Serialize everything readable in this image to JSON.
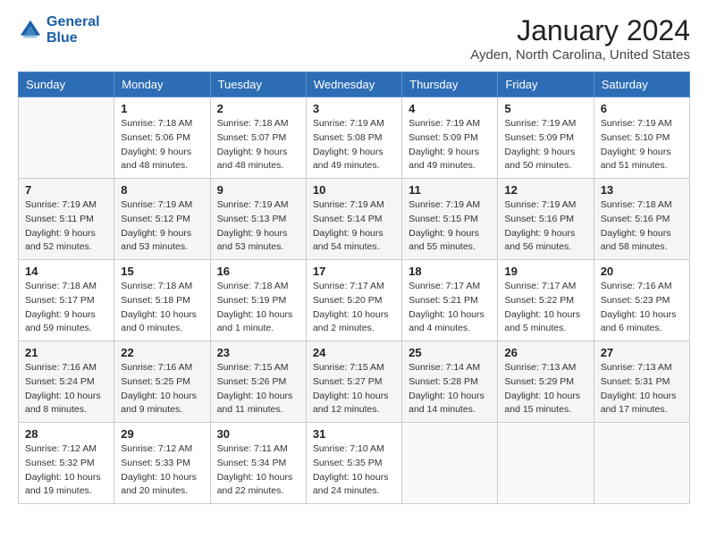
{
  "header": {
    "logo_line1": "General",
    "logo_line2": "Blue",
    "month": "January 2024",
    "location": "Ayden, North Carolina, United States"
  },
  "weekdays": [
    "Sunday",
    "Monday",
    "Tuesday",
    "Wednesday",
    "Thursday",
    "Friday",
    "Saturday"
  ],
  "weeks": [
    [
      {
        "day": "",
        "sunrise": "",
        "sunset": "",
        "daylight": ""
      },
      {
        "day": "1",
        "sunrise": "Sunrise: 7:18 AM",
        "sunset": "Sunset: 5:06 PM",
        "daylight": "Daylight: 9 hours and 48 minutes."
      },
      {
        "day": "2",
        "sunrise": "Sunrise: 7:18 AM",
        "sunset": "Sunset: 5:07 PM",
        "daylight": "Daylight: 9 hours and 48 minutes."
      },
      {
        "day": "3",
        "sunrise": "Sunrise: 7:19 AM",
        "sunset": "Sunset: 5:08 PM",
        "daylight": "Daylight: 9 hours and 49 minutes."
      },
      {
        "day": "4",
        "sunrise": "Sunrise: 7:19 AM",
        "sunset": "Sunset: 5:09 PM",
        "daylight": "Daylight: 9 hours and 49 minutes."
      },
      {
        "day": "5",
        "sunrise": "Sunrise: 7:19 AM",
        "sunset": "Sunset: 5:09 PM",
        "daylight": "Daylight: 9 hours and 50 minutes."
      },
      {
        "day": "6",
        "sunrise": "Sunrise: 7:19 AM",
        "sunset": "Sunset: 5:10 PM",
        "daylight": "Daylight: 9 hours and 51 minutes."
      }
    ],
    [
      {
        "day": "7",
        "sunrise": "Sunrise: 7:19 AM",
        "sunset": "Sunset: 5:11 PM",
        "daylight": "Daylight: 9 hours and 52 minutes."
      },
      {
        "day": "8",
        "sunrise": "Sunrise: 7:19 AM",
        "sunset": "Sunset: 5:12 PM",
        "daylight": "Daylight: 9 hours and 53 minutes."
      },
      {
        "day": "9",
        "sunrise": "Sunrise: 7:19 AM",
        "sunset": "Sunset: 5:13 PM",
        "daylight": "Daylight: 9 hours and 53 minutes."
      },
      {
        "day": "10",
        "sunrise": "Sunrise: 7:19 AM",
        "sunset": "Sunset: 5:14 PM",
        "daylight": "Daylight: 9 hours and 54 minutes."
      },
      {
        "day": "11",
        "sunrise": "Sunrise: 7:19 AM",
        "sunset": "Sunset: 5:15 PM",
        "daylight": "Daylight: 9 hours and 55 minutes."
      },
      {
        "day": "12",
        "sunrise": "Sunrise: 7:19 AM",
        "sunset": "Sunset: 5:16 PM",
        "daylight": "Daylight: 9 hours and 56 minutes."
      },
      {
        "day": "13",
        "sunrise": "Sunrise: 7:18 AM",
        "sunset": "Sunset: 5:16 PM",
        "daylight": "Daylight: 9 hours and 58 minutes."
      }
    ],
    [
      {
        "day": "14",
        "sunrise": "Sunrise: 7:18 AM",
        "sunset": "Sunset: 5:17 PM",
        "daylight": "Daylight: 9 hours and 59 minutes."
      },
      {
        "day": "15",
        "sunrise": "Sunrise: 7:18 AM",
        "sunset": "Sunset: 5:18 PM",
        "daylight": "Daylight: 10 hours and 0 minutes."
      },
      {
        "day": "16",
        "sunrise": "Sunrise: 7:18 AM",
        "sunset": "Sunset: 5:19 PM",
        "daylight": "Daylight: 10 hours and 1 minute."
      },
      {
        "day": "17",
        "sunrise": "Sunrise: 7:17 AM",
        "sunset": "Sunset: 5:20 PM",
        "daylight": "Daylight: 10 hours and 2 minutes."
      },
      {
        "day": "18",
        "sunrise": "Sunrise: 7:17 AM",
        "sunset": "Sunset: 5:21 PM",
        "daylight": "Daylight: 10 hours and 4 minutes."
      },
      {
        "day": "19",
        "sunrise": "Sunrise: 7:17 AM",
        "sunset": "Sunset: 5:22 PM",
        "daylight": "Daylight: 10 hours and 5 minutes."
      },
      {
        "day": "20",
        "sunrise": "Sunrise: 7:16 AM",
        "sunset": "Sunset: 5:23 PM",
        "daylight": "Daylight: 10 hours and 6 minutes."
      }
    ],
    [
      {
        "day": "21",
        "sunrise": "Sunrise: 7:16 AM",
        "sunset": "Sunset: 5:24 PM",
        "daylight": "Daylight: 10 hours and 8 minutes."
      },
      {
        "day": "22",
        "sunrise": "Sunrise: 7:16 AM",
        "sunset": "Sunset: 5:25 PM",
        "daylight": "Daylight: 10 hours and 9 minutes."
      },
      {
        "day": "23",
        "sunrise": "Sunrise: 7:15 AM",
        "sunset": "Sunset: 5:26 PM",
        "daylight": "Daylight: 10 hours and 11 minutes."
      },
      {
        "day": "24",
        "sunrise": "Sunrise: 7:15 AM",
        "sunset": "Sunset: 5:27 PM",
        "daylight": "Daylight: 10 hours and 12 minutes."
      },
      {
        "day": "25",
        "sunrise": "Sunrise: 7:14 AM",
        "sunset": "Sunset: 5:28 PM",
        "daylight": "Daylight: 10 hours and 14 minutes."
      },
      {
        "day": "26",
        "sunrise": "Sunrise: 7:13 AM",
        "sunset": "Sunset: 5:29 PM",
        "daylight": "Daylight: 10 hours and 15 minutes."
      },
      {
        "day": "27",
        "sunrise": "Sunrise: 7:13 AM",
        "sunset": "Sunset: 5:31 PM",
        "daylight": "Daylight: 10 hours and 17 minutes."
      }
    ],
    [
      {
        "day": "28",
        "sunrise": "Sunrise: 7:12 AM",
        "sunset": "Sunset: 5:32 PM",
        "daylight": "Daylight: 10 hours and 19 minutes."
      },
      {
        "day": "29",
        "sunrise": "Sunrise: 7:12 AM",
        "sunset": "Sunset: 5:33 PM",
        "daylight": "Daylight: 10 hours and 20 minutes."
      },
      {
        "day": "30",
        "sunrise": "Sunrise: 7:11 AM",
        "sunset": "Sunset: 5:34 PM",
        "daylight": "Daylight: 10 hours and 22 minutes."
      },
      {
        "day": "31",
        "sunrise": "Sunrise: 7:10 AM",
        "sunset": "Sunset: 5:35 PM",
        "daylight": "Daylight: 10 hours and 24 minutes."
      },
      {
        "day": "",
        "sunrise": "",
        "sunset": "",
        "daylight": ""
      },
      {
        "day": "",
        "sunrise": "",
        "sunset": "",
        "daylight": ""
      },
      {
        "day": "",
        "sunrise": "",
        "sunset": "",
        "daylight": ""
      }
    ]
  ]
}
